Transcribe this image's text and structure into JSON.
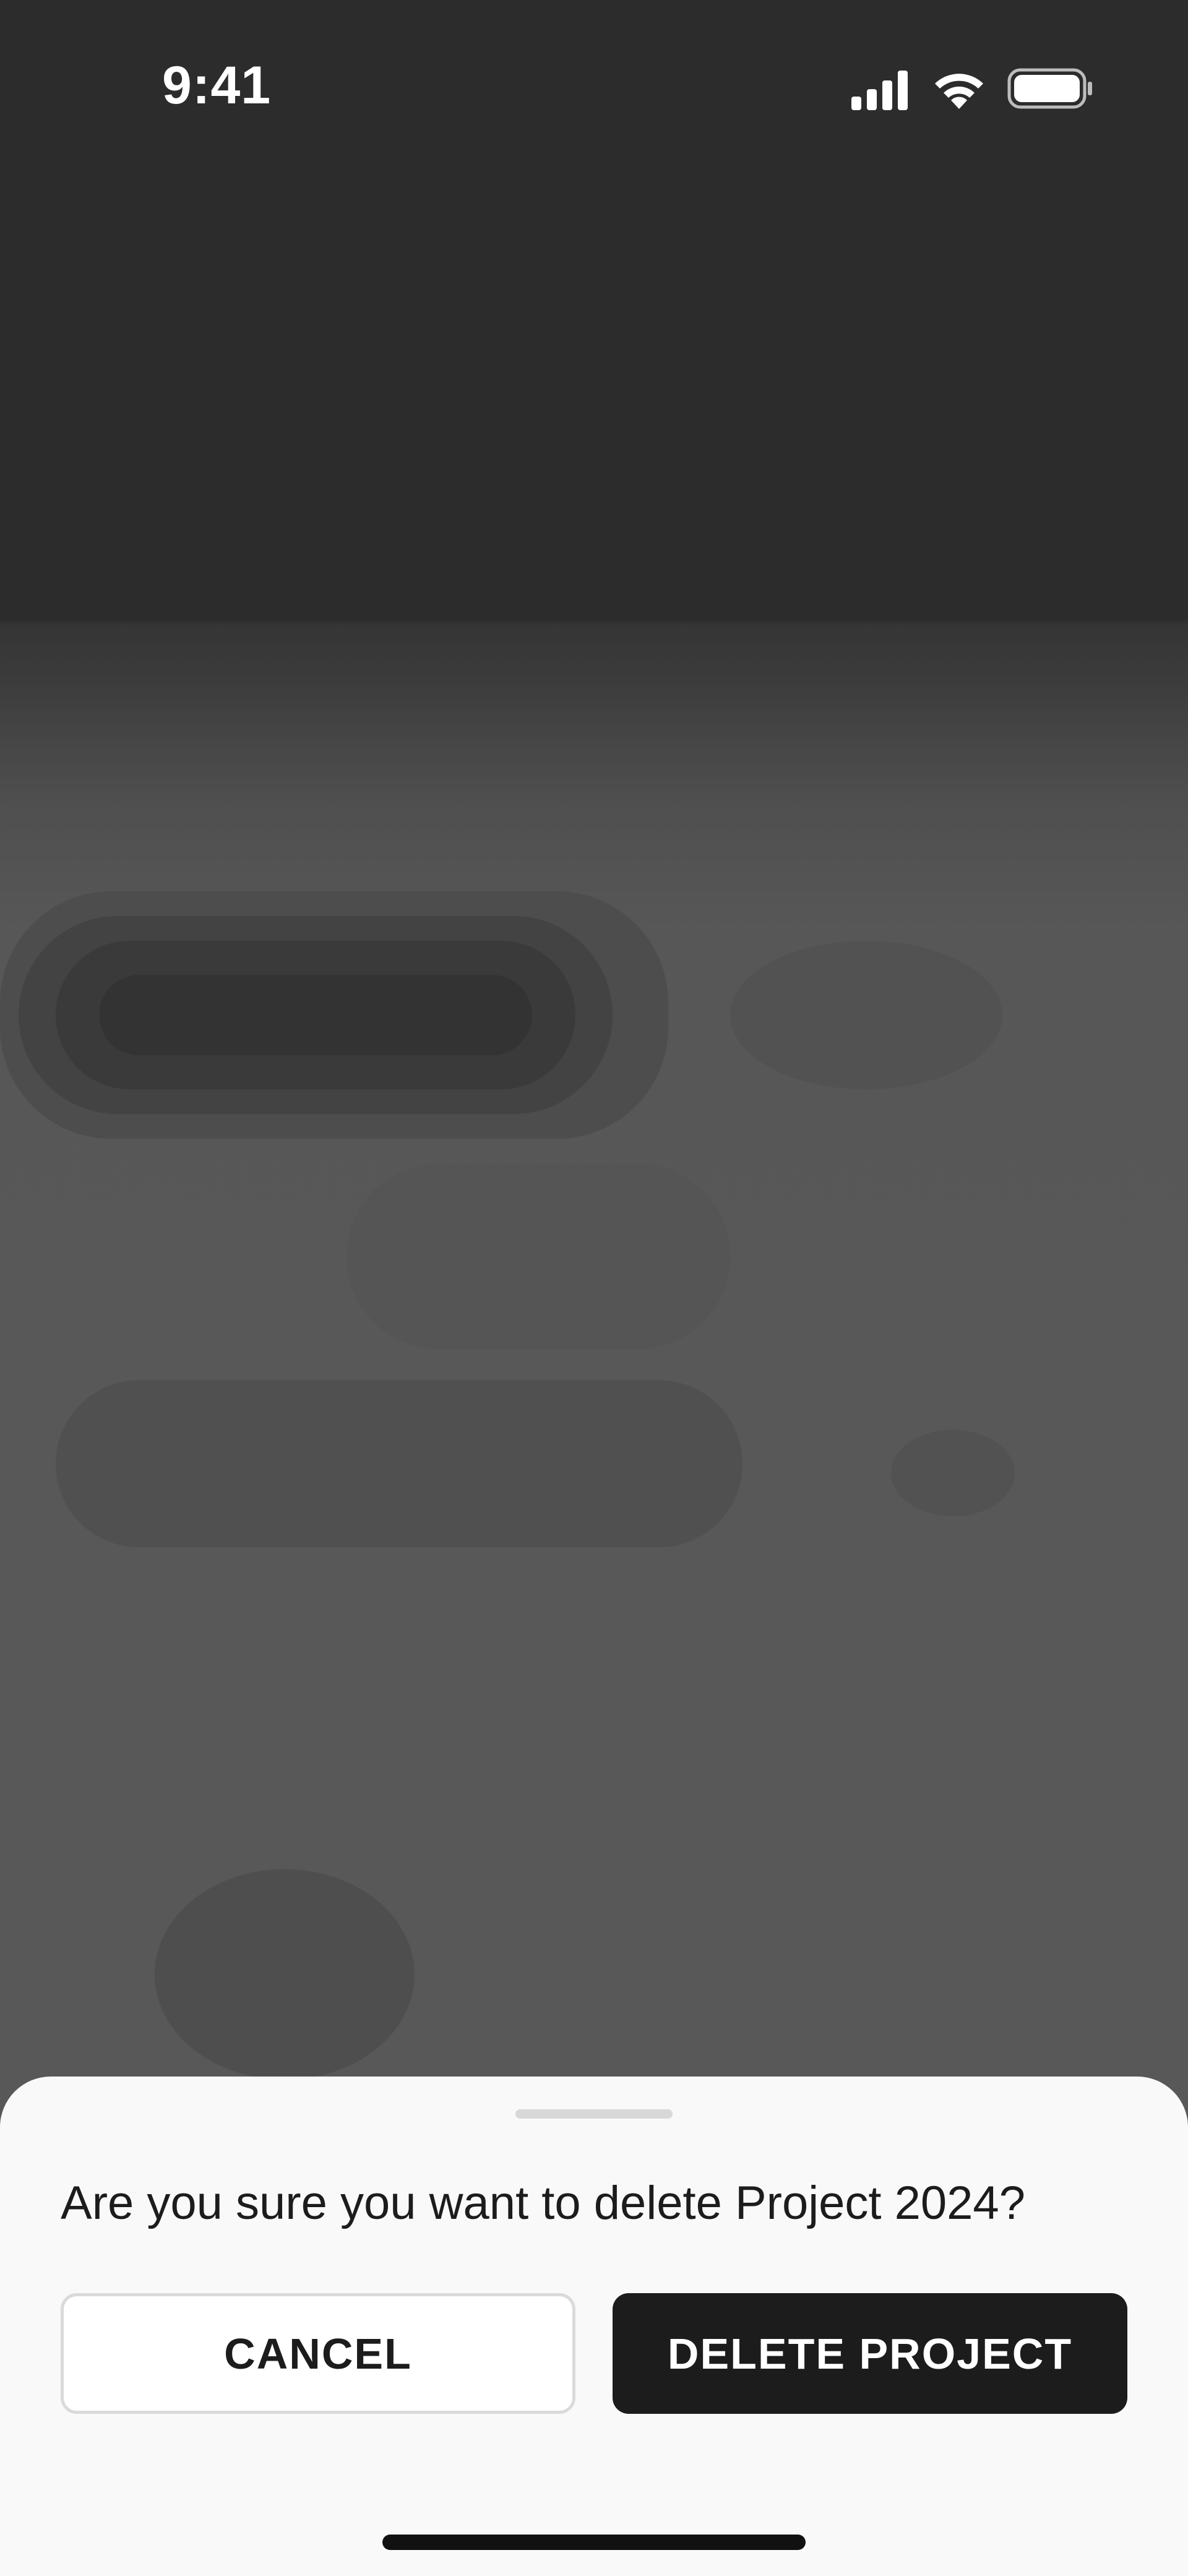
{
  "status_bar": {
    "time": "9:41",
    "icons": [
      "cellular-signal-icon",
      "wifi-icon",
      "battery-icon"
    ]
  },
  "dialog": {
    "message": "Are you sure you want to delete Project 2024?",
    "cancel_label": "CANCEL",
    "delete_label": "DELETE PROJECT"
  },
  "colors": {
    "sheet_background": "#f9f9f9",
    "primary_button": "#1c1c1c",
    "overlay": "#585858"
  }
}
